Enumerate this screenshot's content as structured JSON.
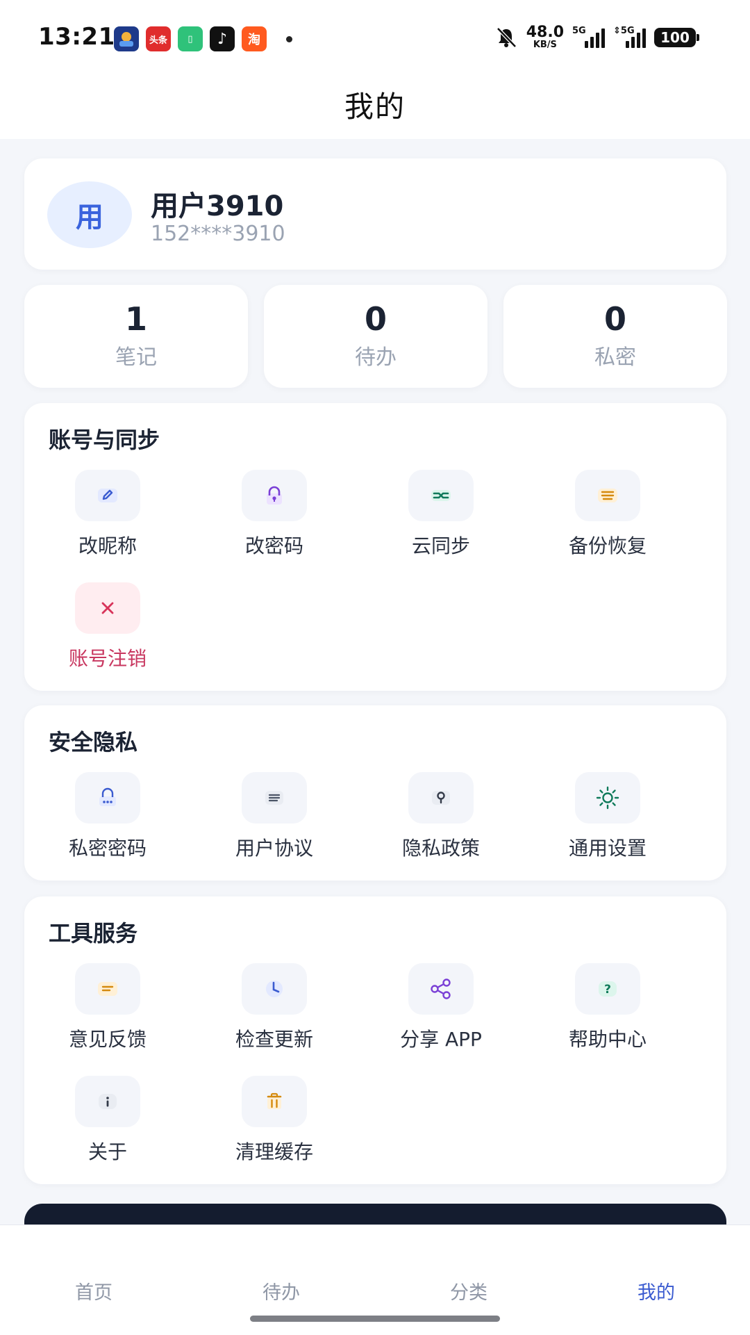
{
  "status_bar": {
    "time": "13:21",
    "apps": [
      {
        "icon": "game-app-icon",
        "color": "#1e3a8a",
        "text": ""
      },
      {
        "icon": "toutiao-app-icon",
        "color": "#e02d2d",
        "text": "头条"
      },
      {
        "icon": "green-app-icon",
        "color": "#2fc27a",
        "text": "▯"
      },
      {
        "icon": "tiktok-app-icon",
        "color": "#111111",
        "text": "♪"
      },
      {
        "icon": "taobao-app-icon",
        "color": "#ff5a1f",
        "text": "淘"
      }
    ],
    "net_speed": "48.0",
    "net_unit": "KB/S",
    "sig1_label": "5G",
    "sig2_label": "⇕5G",
    "battery": "100"
  },
  "header": {
    "title": "我的"
  },
  "profile": {
    "avatar_text": "用",
    "name": "用户3910",
    "phone": "152****3910"
  },
  "stats": [
    {
      "value": "1",
      "label": "笔记"
    },
    {
      "value": "0",
      "label": "待办"
    },
    {
      "value": "0",
      "label": "私密"
    }
  ],
  "sections": {
    "account": {
      "title": "账号与同步",
      "items": [
        {
          "label": "改昵称",
          "icon": "pencil-icon"
        },
        {
          "label": "改密码",
          "icon": "lock-icon"
        },
        {
          "label": "云同步",
          "icon": "sync-icon"
        },
        {
          "label": "备份恢复",
          "icon": "list-icon"
        },
        {
          "label": "账号注销",
          "icon": "close-icon"
        }
      ]
    },
    "security": {
      "title": "安全隐私",
      "items": [
        {
          "label": "私密密码",
          "icon": "password-lock-icon"
        },
        {
          "label": "用户协议",
          "icon": "document-icon"
        },
        {
          "label": "隐私政策",
          "icon": "pin-icon"
        },
        {
          "label": "通用设置",
          "icon": "sun-icon"
        }
      ]
    },
    "tools": {
      "title": "工具服务",
      "items": [
        {
          "label": "意见反馈",
          "icon": "message-icon"
        },
        {
          "label": "检查更新",
          "icon": "clock-icon"
        },
        {
          "label": "分享 APP",
          "icon": "share-icon"
        },
        {
          "label": "帮助中心",
          "icon": "help-icon"
        },
        {
          "label": "关于",
          "icon": "info-icon"
        },
        {
          "label": "清理缓存",
          "icon": "trash-icon"
        }
      ]
    }
  },
  "tabs": [
    {
      "label": "首页"
    },
    {
      "label": "待办"
    },
    {
      "label": "分类"
    },
    {
      "label": "我的",
      "active": true
    }
  ],
  "colors": {
    "accent": "#3a5bd0",
    "danger": "#c8365f",
    "dark_bar": "#141c2f"
  }
}
